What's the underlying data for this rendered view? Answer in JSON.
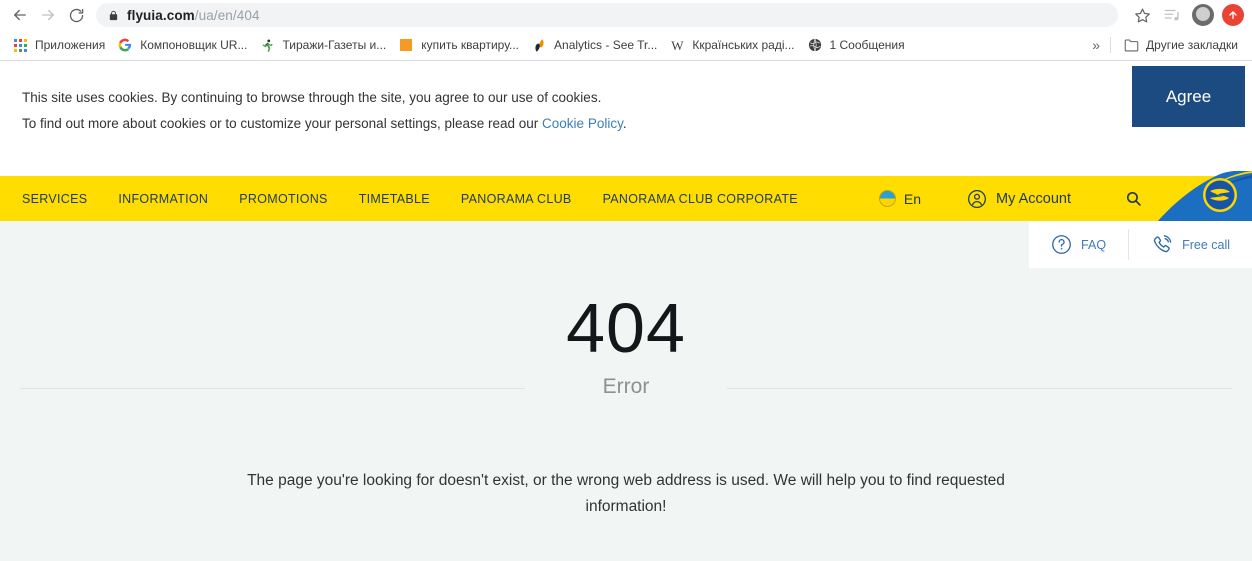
{
  "browser": {
    "back_icon": "back-arrow-icon",
    "forward_icon": "forward-arrow-icon",
    "reload_icon": "reload-icon",
    "lock_icon": "lock-icon",
    "url_host": "flyuia.com",
    "url_path": "/ua/en/404",
    "bookmark_star_icon": "star-icon",
    "reading_list_icon": "reading-list-icon",
    "avatar_icon": "profile-avatar",
    "update_icon": "update-arrow-icon"
  },
  "bookmarks": {
    "apps_label": "Приложения",
    "items": [
      {
        "label": "Компоновщик UR...",
        "icon": "google-g-icon"
      },
      {
        "label": "Тиражи-Газеты и...",
        "icon": "runner-icon"
      },
      {
        "label": "купить квартиру...",
        "icon": "orange-square-icon"
      },
      {
        "label": "Analytics - See Tr...",
        "icon": "analytics-icon"
      },
      {
        "label": "Ккраїнських раді...",
        "icon": "wikipedia-w-icon"
      },
      {
        "label": "1 Сообщения",
        "icon": "globe-icon"
      }
    ],
    "overflow_label": "»",
    "other_bookmarks_label": "Другие закладки",
    "other_bookmarks_icon": "folder-icon"
  },
  "cookie_banner": {
    "line1": "This site uses cookies. By continuing to browse through the site, you agree to our use of cookies.",
    "line2_prefix": "To find out more about cookies or to customize your personal settings, please read our ",
    "policy_link": "Cookie Policy",
    "line2_suffix": ".",
    "agree_label": "Agree",
    "agree_color": "#1c4b82"
  },
  "site_nav": {
    "background": "#ffdd00",
    "items": [
      {
        "label": "SERVICES"
      },
      {
        "label": "INFORMATION"
      },
      {
        "label": "PROMOTIONS"
      },
      {
        "label": "TIMETABLE"
      },
      {
        "label": "PANORAMA CLUB"
      },
      {
        "label": "PANORAMA CLUB CORPORATE"
      }
    ],
    "language": {
      "label": "En",
      "flag_icon": "ukraine-flag-icon"
    },
    "account": {
      "label": "My Account",
      "icon": "user-circle-icon"
    },
    "search_icon": "search-icon",
    "logo": "uia-tail-logo"
  },
  "help_panel": {
    "faq": {
      "label": "FAQ",
      "icon": "question-circle-icon"
    },
    "free_call": {
      "label": "Free call",
      "icon": "phone-ring-icon"
    },
    "link_color": "#3b7bbf"
  },
  "error_page": {
    "code": "404",
    "subtitle": "Error",
    "message": "The page you're looking for doesn't exist, or the wrong web address is used. We will help you to find requested information!"
  }
}
